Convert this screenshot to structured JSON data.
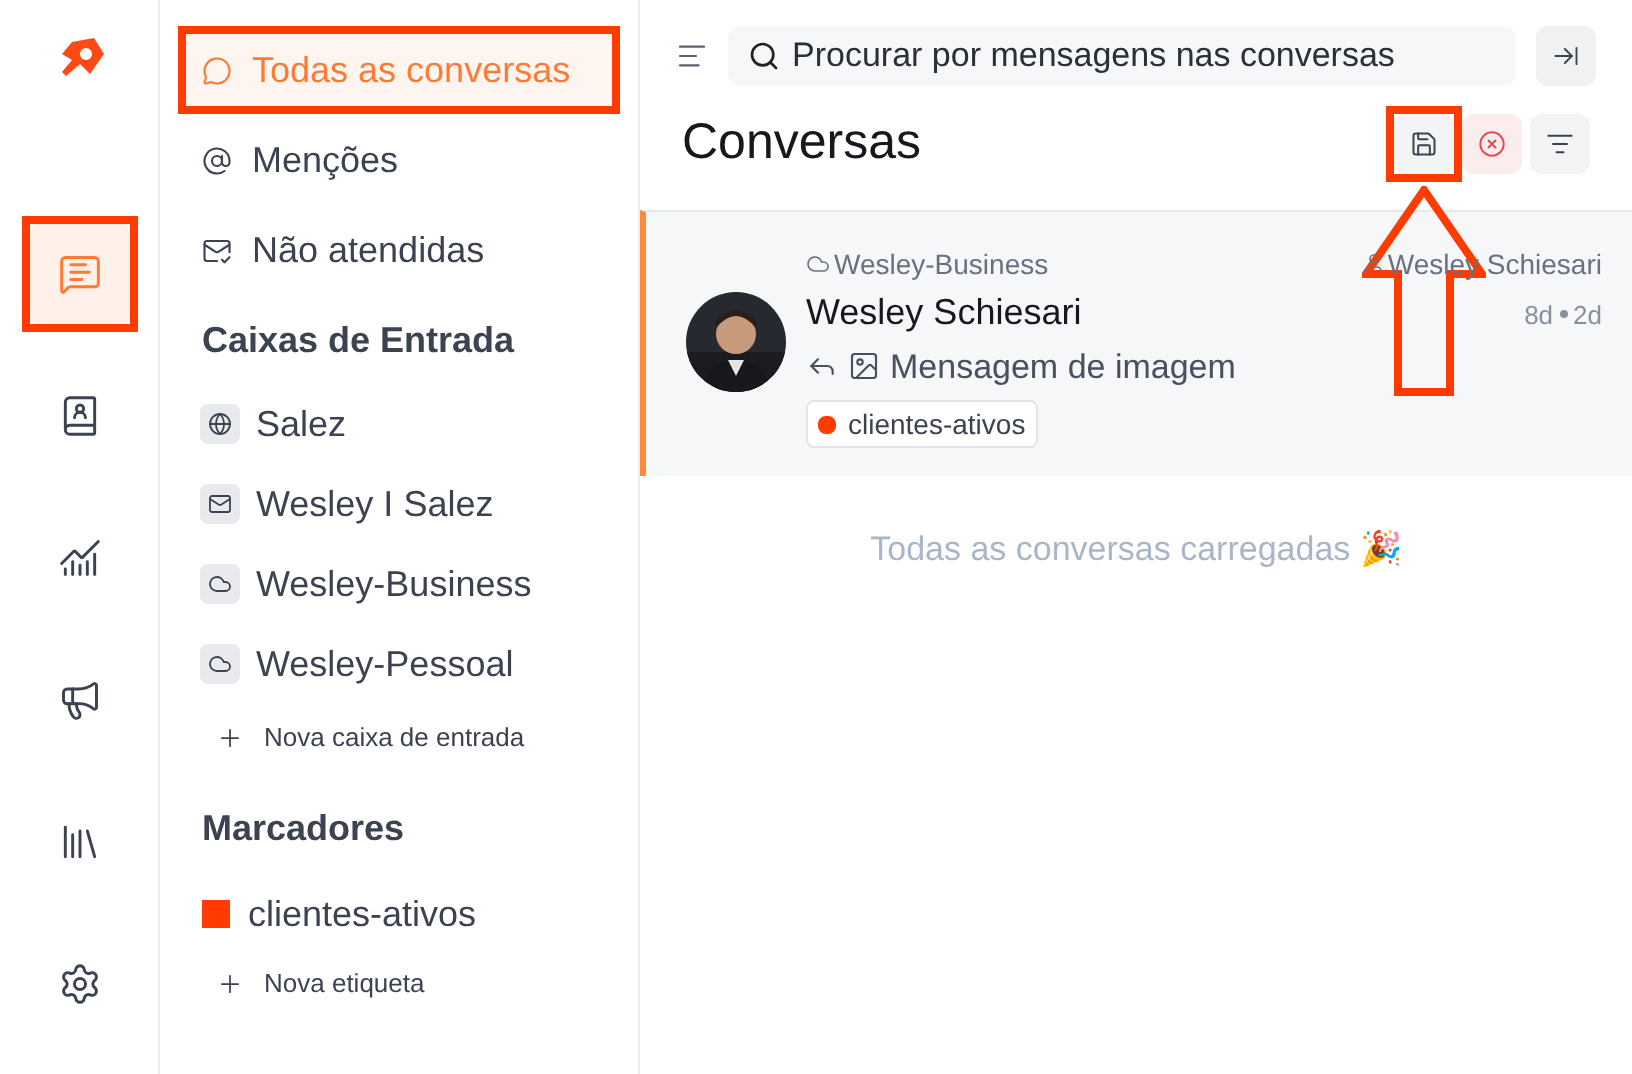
{
  "rail": {
    "items": [
      {
        "kind": "chat",
        "selected": true,
        "highlighted": true
      },
      {
        "kind": "contacts",
        "selected": false,
        "highlighted": false
      },
      {
        "kind": "reports",
        "selected": false,
        "highlighted": false
      },
      {
        "kind": "campaigns",
        "selected": false,
        "highlighted": false
      },
      {
        "kind": "library",
        "selected": false,
        "highlighted": false
      },
      {
        "kind": "settings",
        "selected": false,
        "highlighted": false
      }
    ]
  },
  "sidebar": {
    "views": [
      {
        "kind": "chat",
        "label": "Todas as conversas",
        "selected": true,
        "highlighted": true
      },
      {
        "kind": "mention",
        "label": "Menções",
        "selected": false,
        "highlighted": false
      },
      {
        "kind": "unattended",
        "label": "Não atendidas",
        "selected": false,
        "highlighted": false
      }
    ],
    "inboxes": {
      "title": "Caixas de Entrada",
      "items": [
        {
          "kind": "web",
          "label": "Salez"
        },
        {
          "kind": "email",
          "label": "Wesley I Salez"
        },
        {
          "kind": "api",
          "label": "Wesley-Business"
        },
        {
          "kind": "api",
          "label": "Wesley-Pessoal"
        }
      ],
      "add_label": "Nova caixa de entrada"
    },
    "labels": {
      "title": "Marcadores",
      "items": [
        {
          "label": "clientes-ativos",
          "color": "#ff3b00"
        }
      ],
      "add_label": "Nova etiqueta"
    }
  },
  "header": {
    "search": {
      "placeholder": "Procurar por mensagens nas conversas"
    },
    "title": "Conversas",
    "save_highlighted": true
  },
  "conversations": [
    {
      "inbox": "Wesley-Business",
      "assignee": "Wesley Schiesari",
      "name": "Wesley Schiesari",
      "created": "8d",
      "updated": "2d",
      "preview": "Mensagem de imagem",
      "selected": true,
      "tags": [
        {
          "label": "clientes-ativos",
          "color": "#ff3b00"
        }
      ]
    }
  ],
  "footer": "Todas as conversas carregadas 🎉"
}
